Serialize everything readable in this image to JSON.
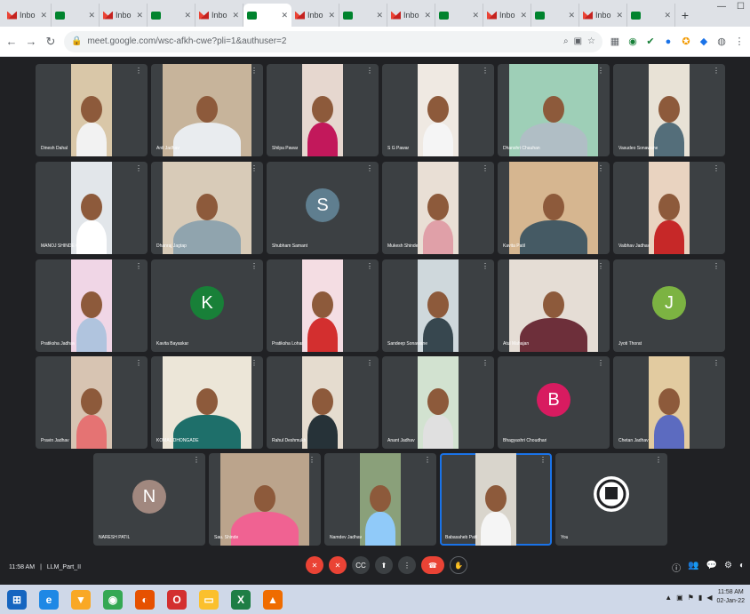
{
  "browser": {
    "tabs": [
      {
        "label": "Inbo",
        "type": "gmail"
      },
      {
        "label": "",
        "type": "meet"
      },
      {
        "label": "Inbo",
        "type": "gmail"
      },
      {
        "label": "",
        "type": "meet"
      },
      {
        "label": "Inbo",
        "type": "gmail"
      },
      {
        "label": "",
        "type": "meet",
        "active": true
      },
      {
        "label": "Inbo",
        "type": "gmail"
      },
      {
        "label": "",
        "type": "meet"
      },
      {
        "label": "Inbo",
        "type": "gmail"
      },
      {
        "label": "",
        "type": "meet"
      },
      {
        "label": "Inbo",
        "type": "gmail"
      },
      {
        "label": "",
        "type": "meet"
      },
      {
        "label": "Inbo",
        "type": "gmail"
      },
      {
        "label": "",
        "type": "meet"
      }
    ],
    "new_tab": "+",
    "url": "meet.google.com/wsc-afkh-cwe?pli=1&authuser=2"
  },
  "participants": [
    {
      "name": "Dinesh Dahal",
      "kind": "video",
      "wall": "#d9c7a8",
      "shirt": "#f2f2f2"
    },
    {
      "name": "Anil Jadhav",
      "kind": "video",
      "wall": "#c7b49b",
      "shirt": "#e9ecef"
    },
    {
      "name": "Shilpa Pawar",
      "kind": "video",
      "wall": "#e6d7cf",
      "shirt": "#c2185b"
    },
    {
      "name": "S G Pawar",
      "kind": "video",
      "wall": "#efe9e2",
      "shirt": "#f5f5f5"
    },
    {
      "name": "Dhanshri Chauhan",
      "kind": "video",
      "wall": "#9ecfb7",
      "shirt": "#b0bec5"
    },
    {
      "name": "Vasudeo Sonawane",
      "kind": "video",
      "wall": "#e8e2d6",
      "shirt": "#546e7a"
    },
    {
      "name": "MANOJ SHINDE GAD",
      "kind": "video",
      "wall": "#e2e6ea",
      "shirt": "#ffffff"
    },
    {
      "name": "Dhanraj Jagtap",
      "kind": "video",
      "wall": "#d8cbb8",
      "shirt": "#90a4ae"
    },
    {
      "name": "Shubham Samant",
      "kind": "avatar",
      "initial": "S",
      "color": "#5f7e8f"
    },
    {
      "name": "Mukesh Shinde",
      "kind": "video",
      "wall": "#e9dfd5",
      "shirt": "#e0a0a8"
    },
    {
      "name": "Kavita Patil",
      "kind": "video",
      "wall": "#d6b690",
      "shirt": "#455a64"
    },
    {
      "name": "Vaibhav Jadhav",
      "kind": "video",
      "wall": "#e9d3c0",
      "shirt": "#c62828"
    },
    {
      "name": "Pratiksha Jadhav",
      "kind": "video",
      "wall": "#f0d6e6",
      "shirt": "#b0c4de"
    },
    {
      "name": "Kavita Bayaskar",
      "kind": "avatar",
      "initial": "K",
      "color": "#188038"
    },
    {
      "name": "Pratiksha Lohar",
      "kind": "video",
      "wall": "#f4dde3",
      "shirt": "#d32f2f"
    },
    {
      "name": "Sandeep Sonawane",
      "kind": "video",
      "wall": "#cfd8dc",
      "shirt": "#37474f"
    },
    {
      "name": "Atul Mahajan",
      "kind": "video",
      "wall": "#e5ddd5",
      "shirt": "#6d2f3a"
    },
    {
      "name": "Jyoti Thorat",
      "kind": "avatar",
      "initial": "J",
      "color": "#7cb342"
    },
    {
      "name": "Pravin Jadhav",
      "kind": "video",
      "wall": "#d7c4b2",
      "shirt": "#e57373"
    },
    {
      "name": "KOMAL DHONGADE",
      "kind": "video",
      "wall": "#ece6d8",
      "shirt": "#1e6f6a"
    },
    {
      "name": "Rahul Deshmukh",
      "kind": "video",
      "wall": "#e5dccf",
      "shirt": "#263238"
    },
    {
      "name": "Anant Jadhav",
      "kind": "video",
      "wall": "#d2e2d0",
      "shirt": "#e0e0e0"
    },
    {
      "name": "Bhagyashri Choudhari",
      "kind": "avatar",
      "initial": "B",
      "color": "#d81b60"
    },
    {
      "name": "Chetan Jadhav",
      "kind": "video",
      "wall": "#e2cba0",
      "shirt": "#5c6bc0"
    },
    {
      "name": "NARESH PATIL",
      "kind": "avatar",
      "initial": "N",
      "color": "#a1887f"
    },
    {
      "name": "Sau. Shinde",
      "kind": "video",
      "wall": "#bba48c",
      "shirt": "#f06292"
    },
    {
      "name": "Namdev Jadhav",
      "kind": "video",
      "wall": "#8aa07a",
      "shirt": "#90caf9"
    },
    {
      "name": "Babasaheb Patil",
      "kind": "video",
      "wall": "#d9d5cc",
      "shirt": "#f5f5f5",
      "speaking": true
    },
    {
      "name": "You",
      "kind": "logo"
    }
  ],
  "meeting": {
    "time": "11:58 AM",
    "separator": "|",
    "code": "LLM_Part_II"
  },
  "controls": {
    "mic": "✕",
    "cam": "✕",
    "cc": "CC",
    "present": "⬆",
    "more": "⋮",
    "end": "☎",
    "raise": "✋"
  },
  "right_controls": [
    "ⓘ",
    "👥",
    "💬",
    "⚙",
    "◐"
  ],
  "taskbar": {
    "apps": [
      {
        "name": "start",
        "glyph": "⊞",
        "color": "#1565c0"
      },
      {
        "name": "internet-explorer",
        "glyph": "e",
        "color": "#1e88e5"
      },
      {
        "name": "security",
        "glyph": "▼",
        "color": "#f9a825"
      },
      {
        "name": "chrome",
        "glyph": "◉",
        "color": "#34a853"
      },
      {
        "name": "firefox",
        "glyph": "◐",
        "color": "#e65100"
      },
      {
        "name": "opera",
        "glyph": "O",
        "color": "#d32f2f"
      },
      {
        "name": "file-explorer",
        "glyph": "▭",
        "color": "#fbc02d"
      },
      {
        "name": "excel",
        "glyph": "X",
        "color": "#1e7e45"
      },
      {
        "name": "vlc",
        "glyph": "▲",
        "color": "#ef6c00"
      }
    ],
    "time": "11:58 AM",
    "date": "02-Jan-22"
  }
}
